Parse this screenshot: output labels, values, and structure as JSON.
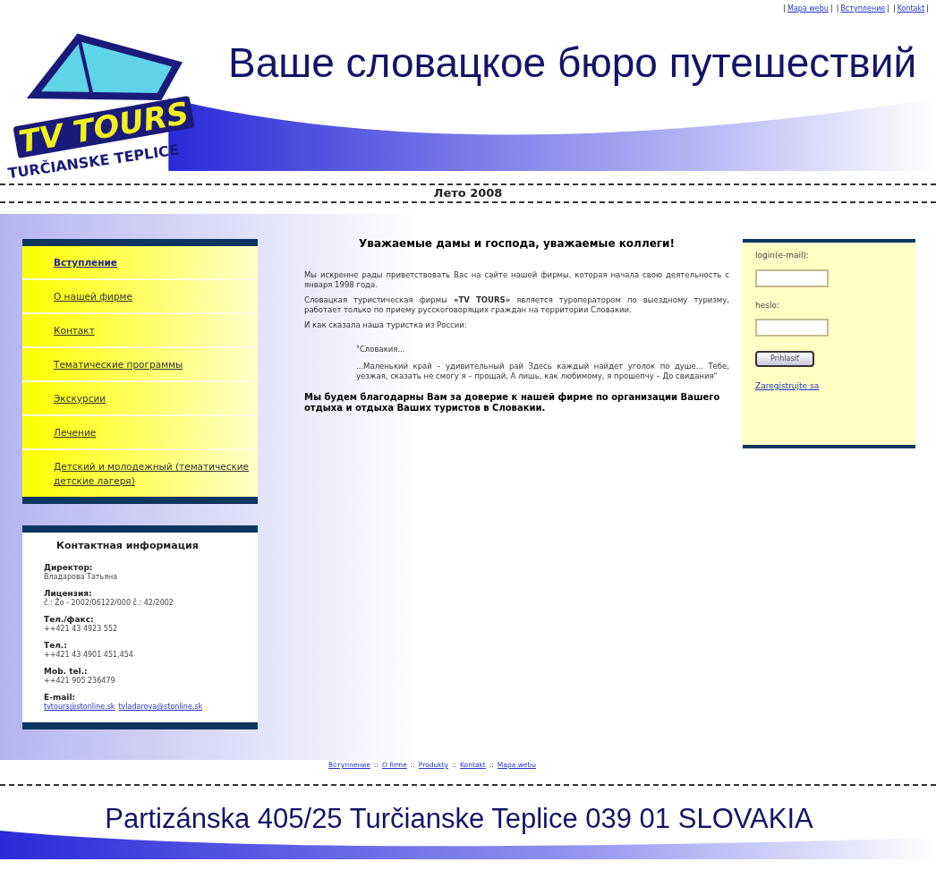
{
  "top_links": {
    "separator": "|",
    "items": [
      "Mapa webu",
      "Вступление",
      "Kontakt"
    ]
  },
  "header": {
    "title": "Ваше словацкое бюро путешествий",
    "logo_main": "TV TOURS",
    "logo_sub": "TURČIANSKE TEPLICE"
  },
  "season": "Лето 2008",
  "menu": [
    {
      "label": "Вступление",
      "selected": true
    },
    {
      "label": "О нашей фирме",
      "selected": false
    },
    {
      "label": "Контакт",
      "selected": false
    },
    {
      "label": "Тематические программы",
      "selected": false
    },
    {
      "label": "Экскурсии",
      "selected": false
    },
    {
      "label": "Лечение",
      "selected": false
    },
    {
      "label": "Детский и молодежный (тематические детские лагеря)",
      "selected": false
    }
  ],
  "contact": {
    "title": "Контактная информация",
    "items": [
      {
        "label": "Директор:",
        "value": "Владарова Татьяна"
      },
      {
        "label": "Лицензия:",
        "value": "č.: Žo - 2002/06122/000 č.: 42/2002"
      },
      {
        "label": "Тел./факс:",
        "value": "++421 43 4923 552"
      },
      {
        "label": "Тел.:",
        "value": "++421 43 4901 451,454"
      },
      {
        "label": "Mob. tel.:",
        "value": "++421 905 236479"
      },
      {
        "label": "E-mail:",
        "links": [
          "tvtours@stonline.sk",
          "tvladarova@stonline.sk"
        ]
      }
    ]
  },
  "main": {
    "heading": "Уважаемые дамы и господа, уважаемые коллеги!",
    "paragraphs": [
      "Мы искренне рады приветствовать Вас на сайте нашей фирмы, которая начала свою деятельность с января 1998 года.",
      "Словацкая туристическая фирмы **«TV TOURS»** является туроператором по выездному туризму, работает только по приему русскоговорящих граждан на территории Словакии.",
      "И как сказала наша туристка из России:"
    ],
    "quote": [
      "\"Словакия...",
      "...Маленький край – удивительный рай Здесь каждый найдет уголок по душе... Тебе, уезжая, сказать не смогу я – прощай, А лишь, как любимому, я прошепчу – До свидания\""
    ],
    "closing": "Мы будем благодарны Вам за доверие к нашей фирме по организации Вашего отдыха и отдыха Ваших туристов в Словакии."
  },
  "login": {
    "email_label": "login(e-mail):",
    "password_label": "heslo:",
    "button": "Prihlasiť",
    "register": "Zaregistrujte sa"
  },
  "footer": {
    "separator": "::",
    "links": [
      "Вступление",
      "O firme",
      "Produkty",
      "Kontakt",
      "Mapa webu"
    ],
    "address": "Partizánska 405/25 Turčianske Teplice 039 01 SLOVAKIA"
  }
}
